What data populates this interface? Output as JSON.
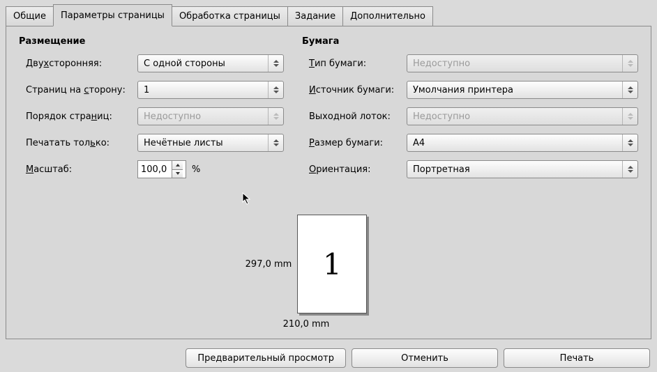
{
  "tabs": {
    "general": "Общие",
    "page_setup": "Параметры страницы",
    "page_processing": "Обработка страницы",
    "job": "Задание",
    "advanced": "Дополнительно"
  },
  "left": {
    "title": "Размещение",
    "duplex_label_pre": "Дву",
    "duplex_label_u": "х",
    "duplex_label_post": "сторонняя:",
    "duplex_value": "С одной стороны",
    "ppside_label_pre": "Страниц на ",
    "ppside_label_u": "с",
    "ppside_label_post": "торону:",
    "ppside_value": "1",
    "order_label_pre": "Порядок стра",
    "order_label_u": "н",
    "order_label_post": "иц:",
    "order_value": "Недоступно",
    "printonly_label_pre": "Печатать тол",
    "printonly_label_u": "ь",
    "printonly_label_post": "ко:",
    "printonly_value": "Нечётные листы",
    "scale_label_u": "М",
    "scale_label_post": "асштаб:",
    "scale_value": "100,0",
    "scale_pct": "%"
  },
  "right": {
    "title": "Бумага",
    "type_label_u": "Т",
    "type_label_post": "ип бумаги:",
    "type_value": "Недоступно",
    "source_label_u": "И",
    "source_label_post": "сточник бумаги:",
    "source_value": "Умолчания принтера",
    "output_label": "Выходной лоток:",
    "output_value": "Недоступно",
    "size_label_u": "Р",
    "size_label_post": "азмер бумаги:",
    "size_value": "A4",
    "orient_label_u": "О",
    "orient_label_post": "риентация:",
    "orient_value": "Портретная"
  },
  "preview": {
    "height": "297,0 mm",
    "width": "210,0 mm",
    "page_num": "1"
  },
  "footer": {
    "preview": "Предварительный просмотр",
    "cancel": "Отменить",
    "print": "Печать"
  }
}
